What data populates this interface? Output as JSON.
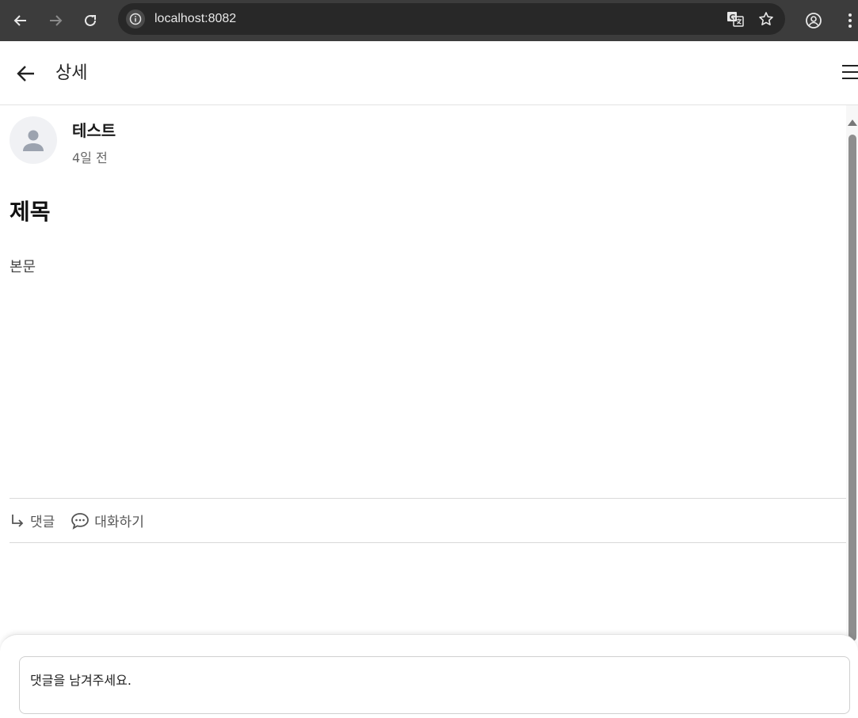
{
  "browser": {
    "url": "localhost:8082"
  },
  "header": {
    "title": "상세"
  },
  "post": {
    "author": "테스트",
    "time": "4일 전",
    "title": "제목",
    "body": "본문"
  },
  "actions": {
    "reply_label": "댓글",
    "chat_label": "대화하기"
  },
  "comment": {
    "placeholder": "댓글을 남겨주세요."
  },
  "icons": {
    "back": "arrow-left-icon",
    "menu": "hamburger-menu-icon",
    "avatar": "person-icon",
    "reply": "reply-arrow-icon",
    "chat": "chat-bubble-icon"
  }
}
